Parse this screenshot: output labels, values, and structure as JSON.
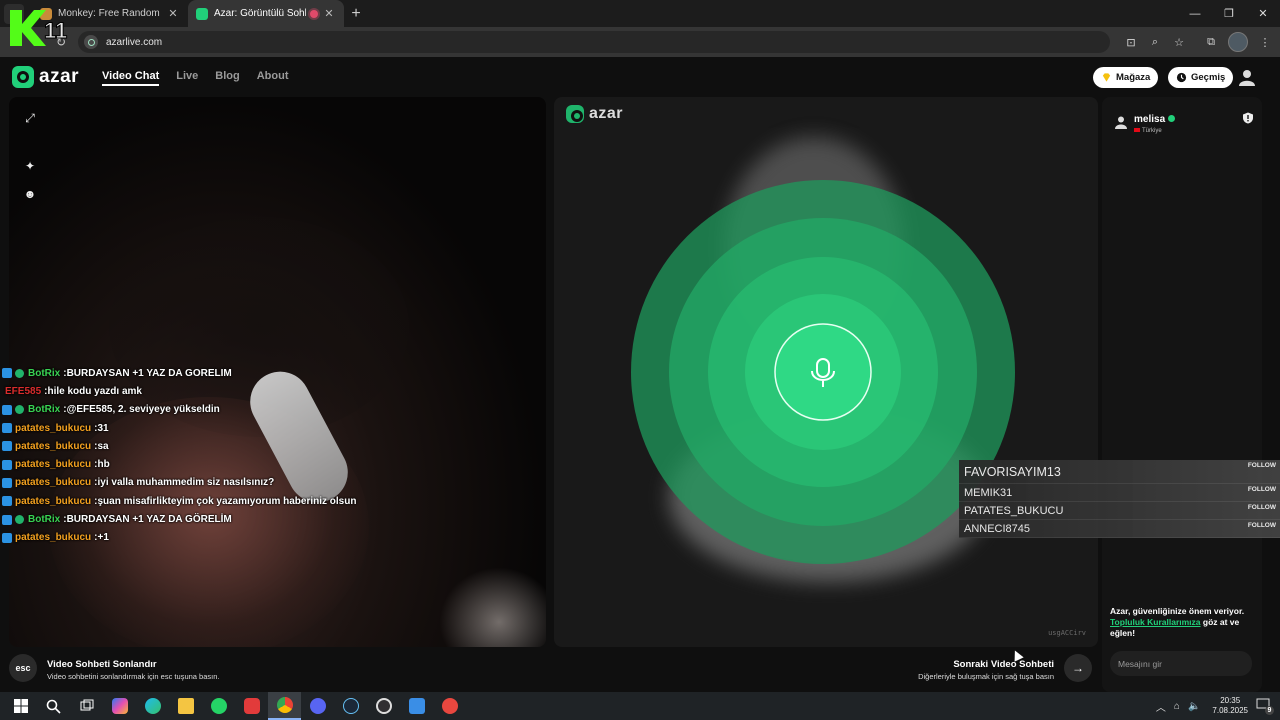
{
  "browser": {
    "tabs": [
      {
        "title": "Monkey: Free Random Video C",
        "active": false
      },
      {
        "title": "Azar: Görüntülü Sohbet, Ar",
        "active": true
      }
    ],
    "url": "azarlive.com",
    "new_tab": "+",
    "close_glyph": "✕"
  },
  "overlay_logo": "11",
  "app": {
    "brand": "azar",
    "nav": [
      "Video Chat",
      "Live",
      "Blog",
      "About"
    ],
    "store_label": "Mağaza",
    "history_label": "Geçmiş",
    "accent": "#21d07a"
  },
  "partner": {
    "name": "melisa",
    "country": "Türkiye"
  },
  "safety": {
    "text1": "Azar, güvenliğinize önem veriyor.",
    "link": "Topluluk Kurallarımıza",
    "text2": " göz at ve eğlen!"
  },
  "message_placeholder": "Mesajını gir",
  "bottom": {
    "esc_key": "esc",
    "end_title": "Video Sohbeti Sonlandır",
    "end_sub": "Video sohbetini sonlandırmak için esc tuşuna basın.",
    "next_title": "Sonraki Video Sohbeti",
    "next_sub": "Diğerleriyle buluşmak için sağ tuşa basın",
    "next_arrow": "→"
  },
  "watermark_code": "usgACCirv",
  "chat": [
    {
      "user": "BotRix",
      "msg": " BURDAYSAN +1 YAZ DA GORELIM",
      "color": "#39d353",
      "badges": 2
    },
    {
      "user": "EFE585",
      "msg": " hile kodu yazdı amk",
      "color": "#d92c2c",
      "badges": 0
    },
    {
      "user": "BotRix",
      "msg": " @EFE585, 2. seviyeye yükseldin",
      "color": "#39d353",
      "badges": 2
    },
    {
      "user": "patates_bukucu",
      "msg": " 31",
      "color": "#f2a01f",
      "badges": 1
    },
    {
      "user": "patates_bukucu",
      "msg": " sa",
      "color": "#f2a01f",
      "badges": 1
    },
    {
      "user": "patates_bukucu",
      "msg": " hb",
      "color": "#f2a01f",
      "badges": 1
    },
    {
      "user": "patates_bukucu",
      "msg": " iyi valla muhammedim siz nasılsınız?",
      "color": "#f2a01f",
      "badges": 1
    },
    {
      "user": "patates_bukucu",
      "msg": " şuan misafirlikteyim çok yazamıyorum haberiniz olsun",
      "color": "#f2a01f",
      "badges": 1
    },
    {
      "user": "BotRix",
      "msg": " BURDAYSAN +1 YAZ DA GÖRELİM",
      "color": "#39d353",
      "badges": 2
    },
    {
      "user": "patates_bukucu",
      "msg": " +1",
      "color": "#f2a01f",
      "badges": 1
    }
  ],
  "follows": [
    {
      "name": "FAVORISAYIM13",
      "label": "FOLLOW",
      "big": true
    },
    {
      "name": "MEMIK31",
      "label": "FOLLOW",
      "big": false
    },
    {
      "name": "PATATES_BUKUCU",
      "label": "FOLLOW",
      "big": false
    },
    {
      "name": "ANNECI8745",
      "label": "FOLLOW",
      "big": false
    }
  ],
  "taskbar": {
    "time": "20:35",
    "date": "7.08.2025",
    "notifications": "9"
  }
}
